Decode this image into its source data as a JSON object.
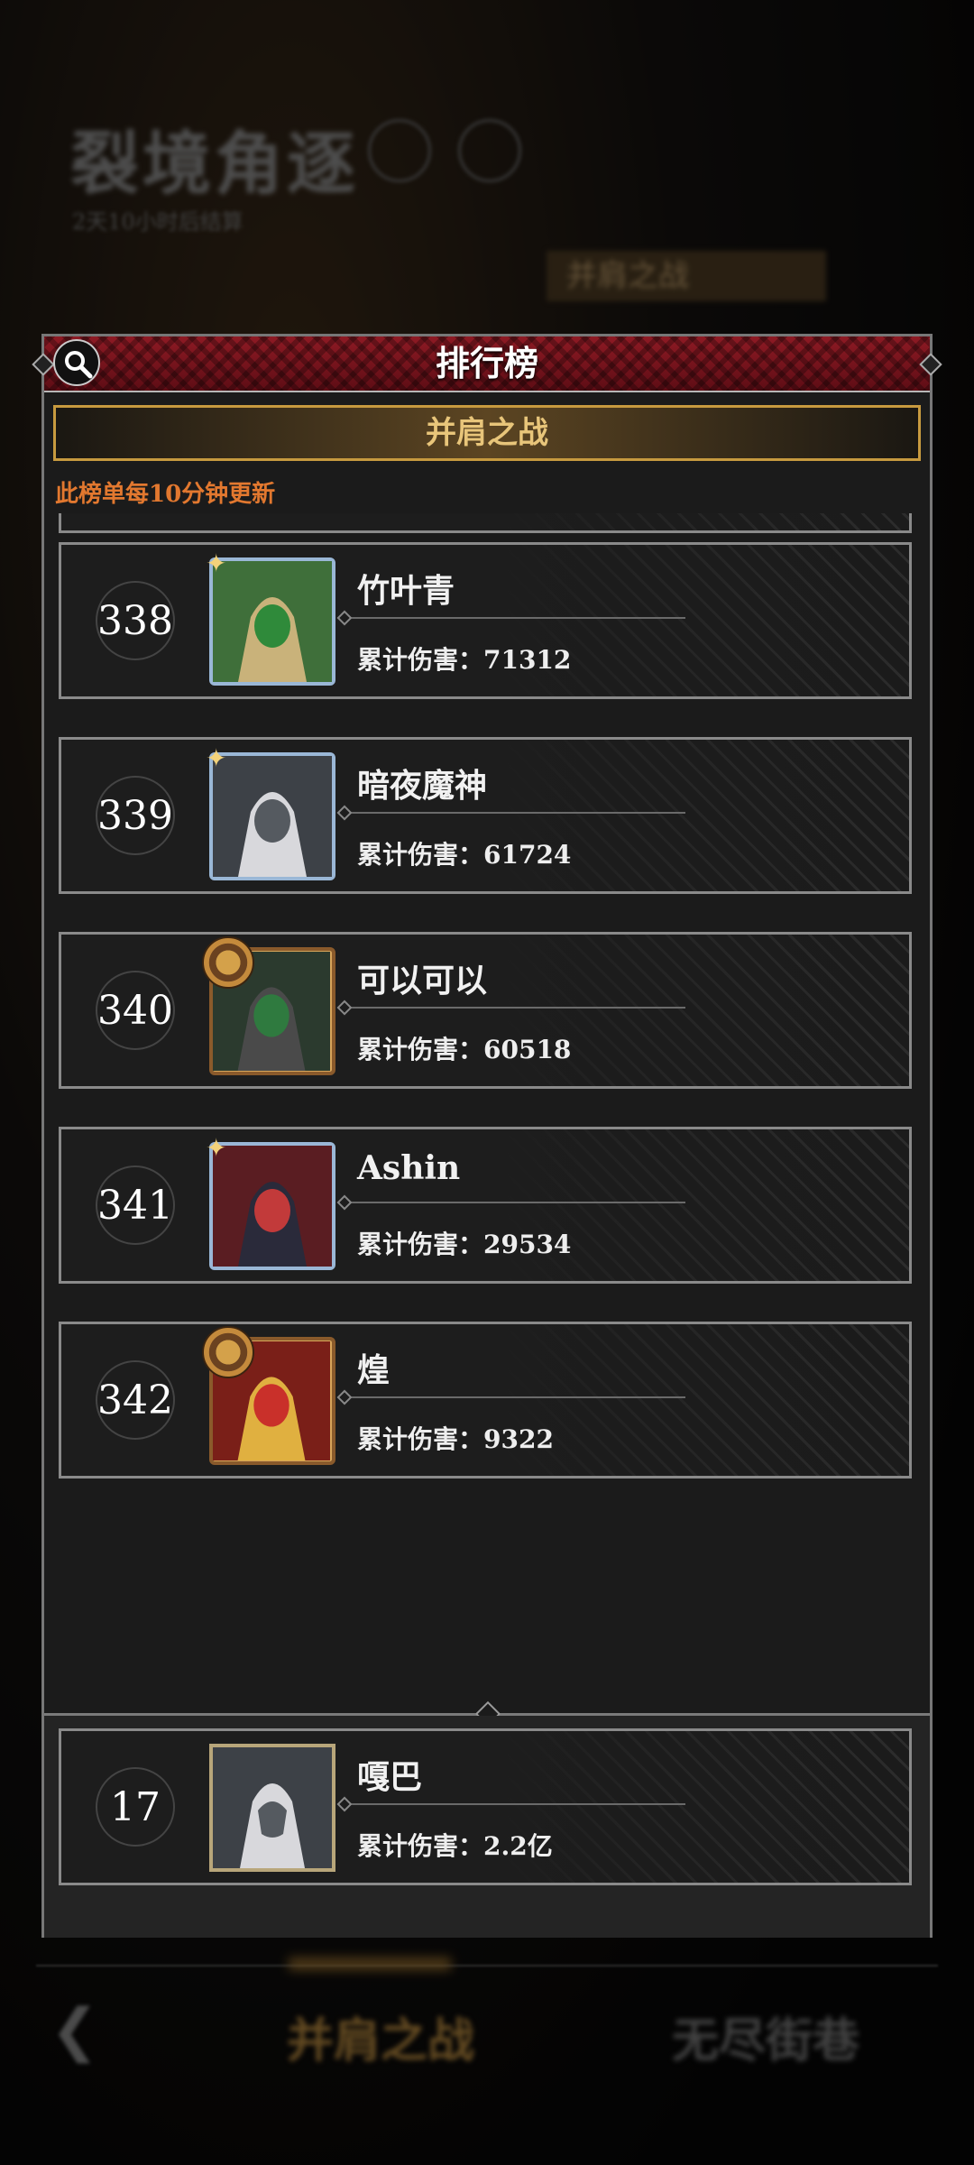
{
  "background": {
    "title": "裂境角逐",
    "subtitle": "2天10小时后结算",
    "side_tab": "并肩之战",
    "bottom_tabs": [
      "并肩之战",
      "无尽街巷"
    ]
  },
  "modal": {
    "title": "排行榜",
    "banner": "并肩之战",
    "update_note": "此榜单每10分钟更新",
    "entries": [
      {
        "rank": "338",
        "name": "竹叶青",
        "damage": "累计伤害：71312",
        "frame": "blue"
      },
      {
        "rank": "339",
        "name": "暗夜魔神",
        "damage": "累计伤害：61724",
        "frame": "blue"
      },
      {
        "rank": "340",
        "name": "可以可以",
        "damage": "累计伤害：60518",
        "frame": "gold"
      },
      {
        "rank": "341",
        "name": "Ashin",
        "damage": "累计伤害：29534",
        "frame": "blue"
      },
      {
        "rank": "342",
        "name": "煌",
        "damage": "累计伤害：9322",
        "frame": "gold"
      }
    ],
    "self": {
      "rank": "17",
      "name": "嘎巴",
      "damage": "累计伤害：2.2亿",
      "frame": "plain"
    }
  },
  "colors": {
    "header_red": "#8e1a24",
    "banner_gold": "#e8c57a",
    "note_orange": "#e2782f"
  }
}
